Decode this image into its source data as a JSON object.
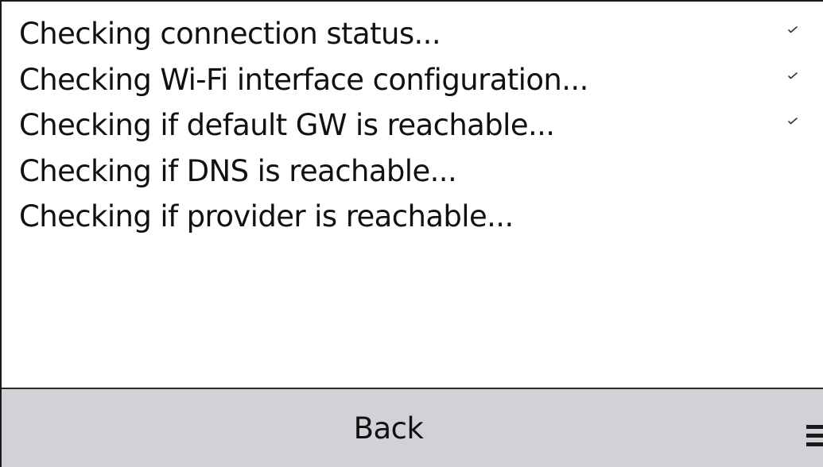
{
  "checks": [
    {
      "label": "Checking connection status...",
      "status": "passed"
    },
    {
      "label": "Checking Wi-Fi interface configuration...",
      "status": "passed"
    },
    {
      "label": "Checking if default GW is reachable...",
      "status": "passed"
    },
    {
      "label": "Checking if DNS is reachable...",
      "status": "pending"
    },
    {
      "label": "Checking if provider is reachable...",
      "status": "pending"
    }
  ],
  "bottom_bar": {
    "back_label": "Back",
    "menu_icon": "hamburger-menu-icon"
  },
  "colors": {
    "background": "#ffffff",
    "bottom_bar": "#d2d1d5",
    "text": "#111111",
    "checkmark": "#333333"
  }
}
